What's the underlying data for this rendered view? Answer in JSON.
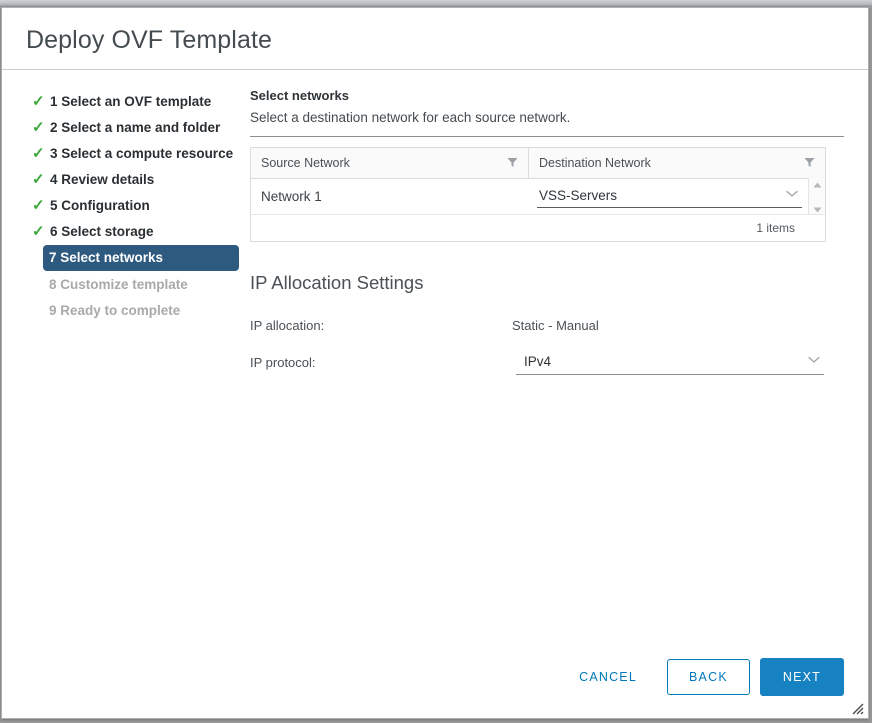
{
  "window": {
    "title": "Deploy OVF Template"
  },
  "steps": [
    {
      "label": "1 Select an OVF template",
      "state": "done"
    },
    {
      "label": "2 Select a name and folder",
      "state": "done"
    },
    {
      "label": "3 Select a compute resource",
      "state": "done"
    },
    {
      "label": "4 Review details",
      "state": "done"
    },
    {
      "label": "5 Configuration",
      "state": "done"
    },
    {
      "label": "6 Select storage",
      "state": "done"
    },
    {
      "label": "7 Select networks",
      "state": "current"
    },
    {
      "label": "8 Customize template",
      "state": "pending"
    },
    {
      "label": "9 Ready to complete",
      "state": "pending"
    }
  ],
  "content": {
    "heading": "Select networks",
    "subheading": "Select a destination network for each source network."
  },
  "networks_table": {
    "columns": [
      "Source Network",
      "Destination Network"
    ],
    "rows": [
      {
        "source": "Network 1",
        "destination": "VSS-Servers"
      }
    ],
    "footer_count": "1 items"
  },
  "ip_allocation": {
    "title": "IP Allocation Settings",
    "allocation_label": "IP allocation:",
    "allocation_value": "Static - Manual",
    "protocol_label": "IP protocol:",
    "protocol_value": "IPv4"
  },
  "footer": {
    "cancel_label": "CANCEL",
    "back_label": "BACK",
    "next_label": "NEXT"
  },
  "colors": {
    "accent_blue": "#0079b8",
    "primary_button": "#1782c1",
    "active_step": "#2f5a80",
    "check_green": "#3aa83a",
    "disabled_text": "#a9a9a9"
  }
}
